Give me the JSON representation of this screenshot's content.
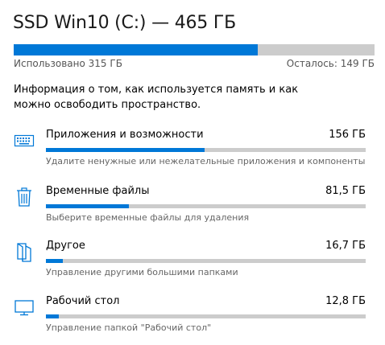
{
  "drive": {
    "title": "SSD Win10 (C:) — 465 ГБ",
    "used_label": "Использовано 315 ГБ",
    "free_label": "Осталось: 149 ГБ",
    "used_fraction": 0.677
  },
  "info": {
    "text": "Информация о том, как используется память и как можно освободить пространство."
  },
  "categories": [
    {
      "name": "Приложения и возможности",
      "size": "156 ГБ",
      "description": "Удалите ненужные или нежелательные приложения и компоненты",
      "icon": "apps-keyboard-icon",
      "fraction": 0.495
    },
    {
      "name": "Временные файлы",
      "size": "81,5 ГБ",
      "description": "Выберите временные файлы для удаления",
      "icon": "trash-icon",
      "fraction": 0.259
    },
    {
      "name": "Другое",
      "size": "16,7 ГБ",
      "description": "Управление другими большими папками",
      "icon": "file-icon",
      "fraction": 0.053
    },
    {
      "name": "Рабочий стол",
      "size": "12,8 ГБ",
      "description": "Управление папкой \"Рабочий стол\"",
      "icon": "monitor-icon",
      "fraction": 0.041
    }
  ],
  "colors": {
    "accent": "#0078d7",
    "track": "#cccccc",
    "secondary_text": "#666666"
  }
}
